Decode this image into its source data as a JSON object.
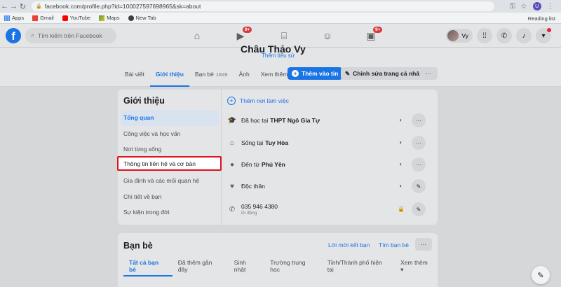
{
  "browser": {
    "url": "facebook.com/profile.php?id=100027597698965&sk=about",
    "bookmarks": [
      "Apps",
      "Gmail",
      "YouTube",
      "Maps",
      "New Tab"
    ],
    "reading_list": "Reading list",
    "profile_initial": "U"
  },
  "fb": {
    "search_placeholder": "Tìm kiếm trên Facebook",
    "nav_badges": {
      "watch": "9+",
      "groups": "9+"
    },
    "user_name": "Vy"
  },
  "profile": {
    "name": "Châu Thảo Vy",
    "add_bio": "Thêm tiểu sử",
    "tabs": [
      {
        "label": "Bài viết"
      },
      {
        "label": "Giới thiệu"
      },
      {
        "label": "Bạn bè",
        "count": "1849"
      },
      {
        "label": "Ảnh"
      },
      {
        "label": "Xem thêm ▾"
      }
    ],
    "add_story": "Thêm vào tin",
    "edit_profile": "Chỉnh sửa trang cá nhân",
    "more": "···"
  },
  "about": {
    "title": "Giới thiệu",
    "menu": [
      "Tổng quan",
      "Công việc và học vấn",
      "Nơi từng sống",
      "Thông tin liên hệ và cơ bản",
      "Gia đình và các mối quan hệ",
      "Chi tiết về bạn",
      "Sự kiện trong đời"
    ],
    "add_work": "Thêm nơi làm việc",
    "rows": {
      "school_prefix": "Đã học tại",
      "school": "THPT Ngô Gia Tự",
      "lives_prefix": "Sống tại",
      "lives": "Tuy Hòa",
      "from_prefix": "Đến từ",
      "from": "Phú Yên",
      "relationship": "Độc thân",
      "phone": "035 946 4380",
      "phone_type": "Di động"
    }
  },
  "friends": {
    "title": "Bạn bè",
    "requests": "Lời mời kết bạn",
    "find": "Tìm bạn bè",
    "more": "···",
    "tabs": [
      "Tất cả bạn bè",
      "Đã thêm gần đây",
      "Sinh nhật",
      "Trường trung học",
      "Tỉnh/Thành phố hiện tại",
      "Xem thêm ▾"
    ]
  }
}
